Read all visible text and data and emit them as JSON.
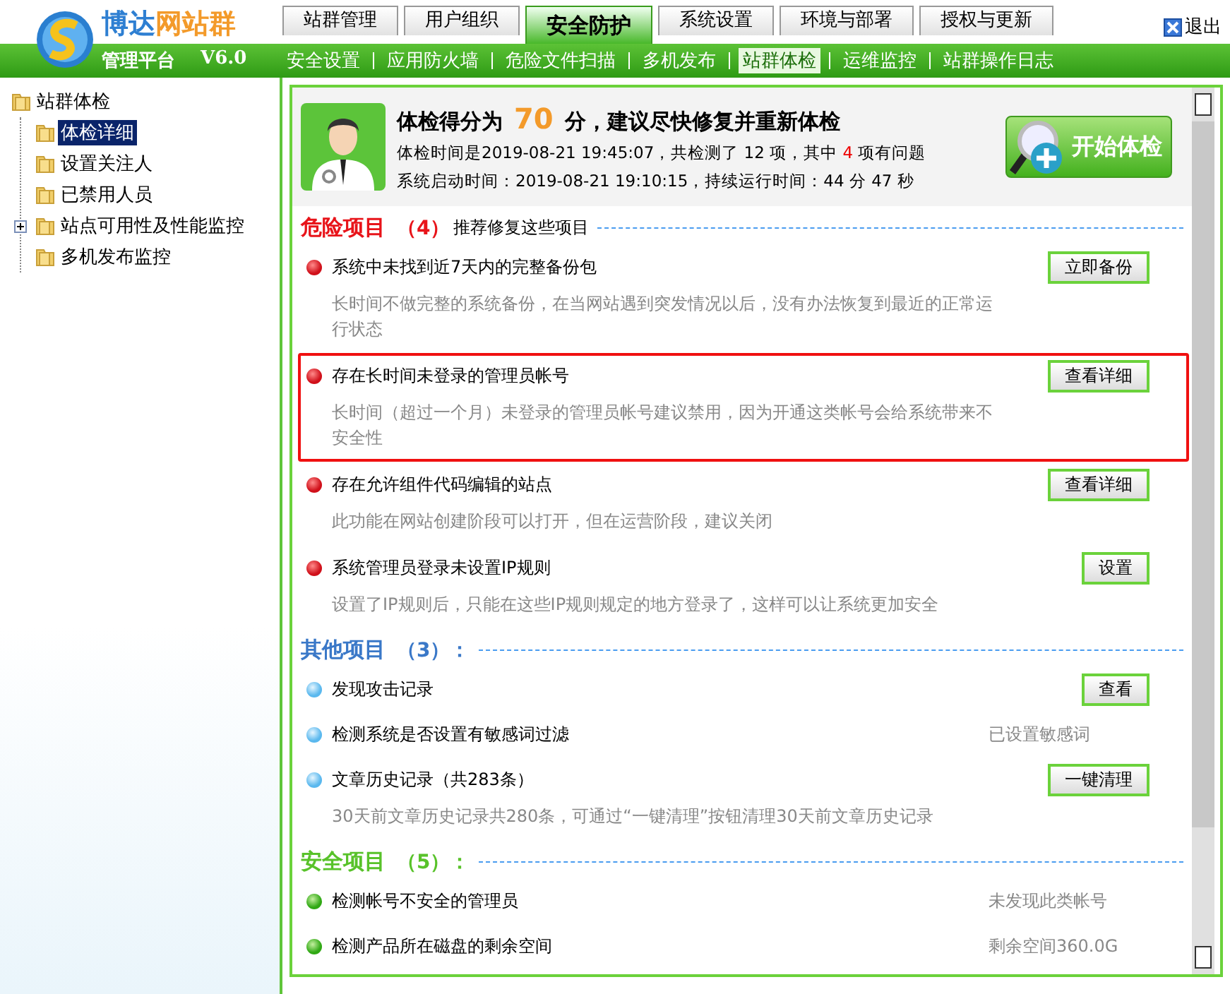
{
  "header": {
    "logo_text_a": "博达",
    "logo_text_b": "网站群",
    "subtitle": "管理平台",
    "version": "V6.0",
    "exit": "退出"
  },
  "tabs": [
    {
      "label": "站群管理",
      "selected": false
    },
    {
      "label": "用户组织",
      "selected": false
    },
    {
      "label": "安全防护",
      "selected": true
    },
    {
      "label": "系统设置",
      "selected": false
    },
    {
      "label": "环境与部署",
      "selected": false
    },
    {
      "label": "授权与更新",
      "selected": false
    }
  ],
  "subnav": [
    {
      "label": "安全设置",
      "selected": false
    },
    {
      "label": "应用防火墙",
      "selected": false
    },
    {
      "label": "危险文件扫描",
      "selected": false
    },
    {
      "label": "多机发布",
      "selected": false
    },
    {
      "label": "站群体检",
      "selected": true
    },
    {
      "label": "运维监控",
      "selected": false
    },
    {
      "label": "站群操作日志",
      "selected": false
    }
  ],
  "tree": {
    "label": "站群体检",
    "children": [
      {
        "label": "体检详细",
        "selected": true,
        "expandable": false
      },
      {
        "label": "设置关注人",
        "selected": false,
        "expandable": false
      },
      {
        "label": "已禁用人员",
        "selected": false,
        "expandable": false
      },
      {
        "label": "站点可用性及性能监控",
        "selected": false,
        "expandable": true
      },
      {
        "label": "多机发布监控",
        "selected": false,
        "expandable": false
      }
    ]
  },
  "summary": {
    "headline_a": "体检得分为",
    "score": "70",
    "headline_b": "分，建议尽快修复并重新体检",
    "check_line": "体检时间是2019-08-21 19:45:07，共检测了 12 项，其中 **4** 项有问题",
    "uptime_line": "系统启动时间：2019-08-21 19:10:15，持续运行时间：44 分 47 秒",
    "start_button": "开始体检"
  },
  "sections": [
    {
      "kind": "danger",
      "title": "危险项目",
      "count": "（4）",
      "note": "推荐修复这些项目",
      "items": [
        {
          "title": "系统中未找到近7天内的完整备份包",
          "button": "立即备份",
          "description": "长时间不做完整的系统备份，在当网站遇到突发情况以后，没有办法恢复到最近的正常运行状态",
          "highlighted": false
        },
        {
          "title": "存在长时间未登录的管理员帐号",
          "button": "查看详细",
          "description": "长时间（超过一个月）未登录的管理员帐号建议禁用，因为开通这类帐号会给系统带来不安全性",
          "highlighted": true
        },
        {
          "title": "存在允许组件代码编辑的站点",
          "button": "查看详细",
          "description": "此功能在网站创建阶段可以打开，但在运营阶段，建议关闭",
          "highlighted": false
        },
        {
          "title": "系统管理员登录未设置IP规则",
          "button": "设置",
          "description": "设置了IP规则后，只能在这些IP规则规定的地方登录了，这样可以让系统更加安全",
          "highlighted": false
        }
      ]
    },
    {
      "kind": "other",
      "title": "其他项目",
      "count": "（3）：",
      "items": [
        {
          "title": "发现攻击记录",
          "button": "查看",
          "highlighted": false
        },
        {
          "title": "检测系统是否设置有敏感词过滤",
          "status": "已设置敏感词",
          "highlighted": false
        },
        {
          "title": "文章历史记录（共283条）",
          "button": "一键清理",
          "description": "30天前文章历史记录共280条，可通过“一键清理”按钮清理30天前文章历史记录",
          "highlighted": false
        }
      ]
    },
    {
      "kind": "safe",
      "title": "安全项目",
      "count": "（5）：",
      "items": [
        {
          "title": "检测帐号不安全的管理员",
          "status": "未发现此类帐号",
          "highlighted": false
        },
        {
          "title": "检测产品所在磁盘的剩余空间",
          "status": "剩余空间360.0G",
          "highlighted": false
        }
      ]
    }
  ]
}
